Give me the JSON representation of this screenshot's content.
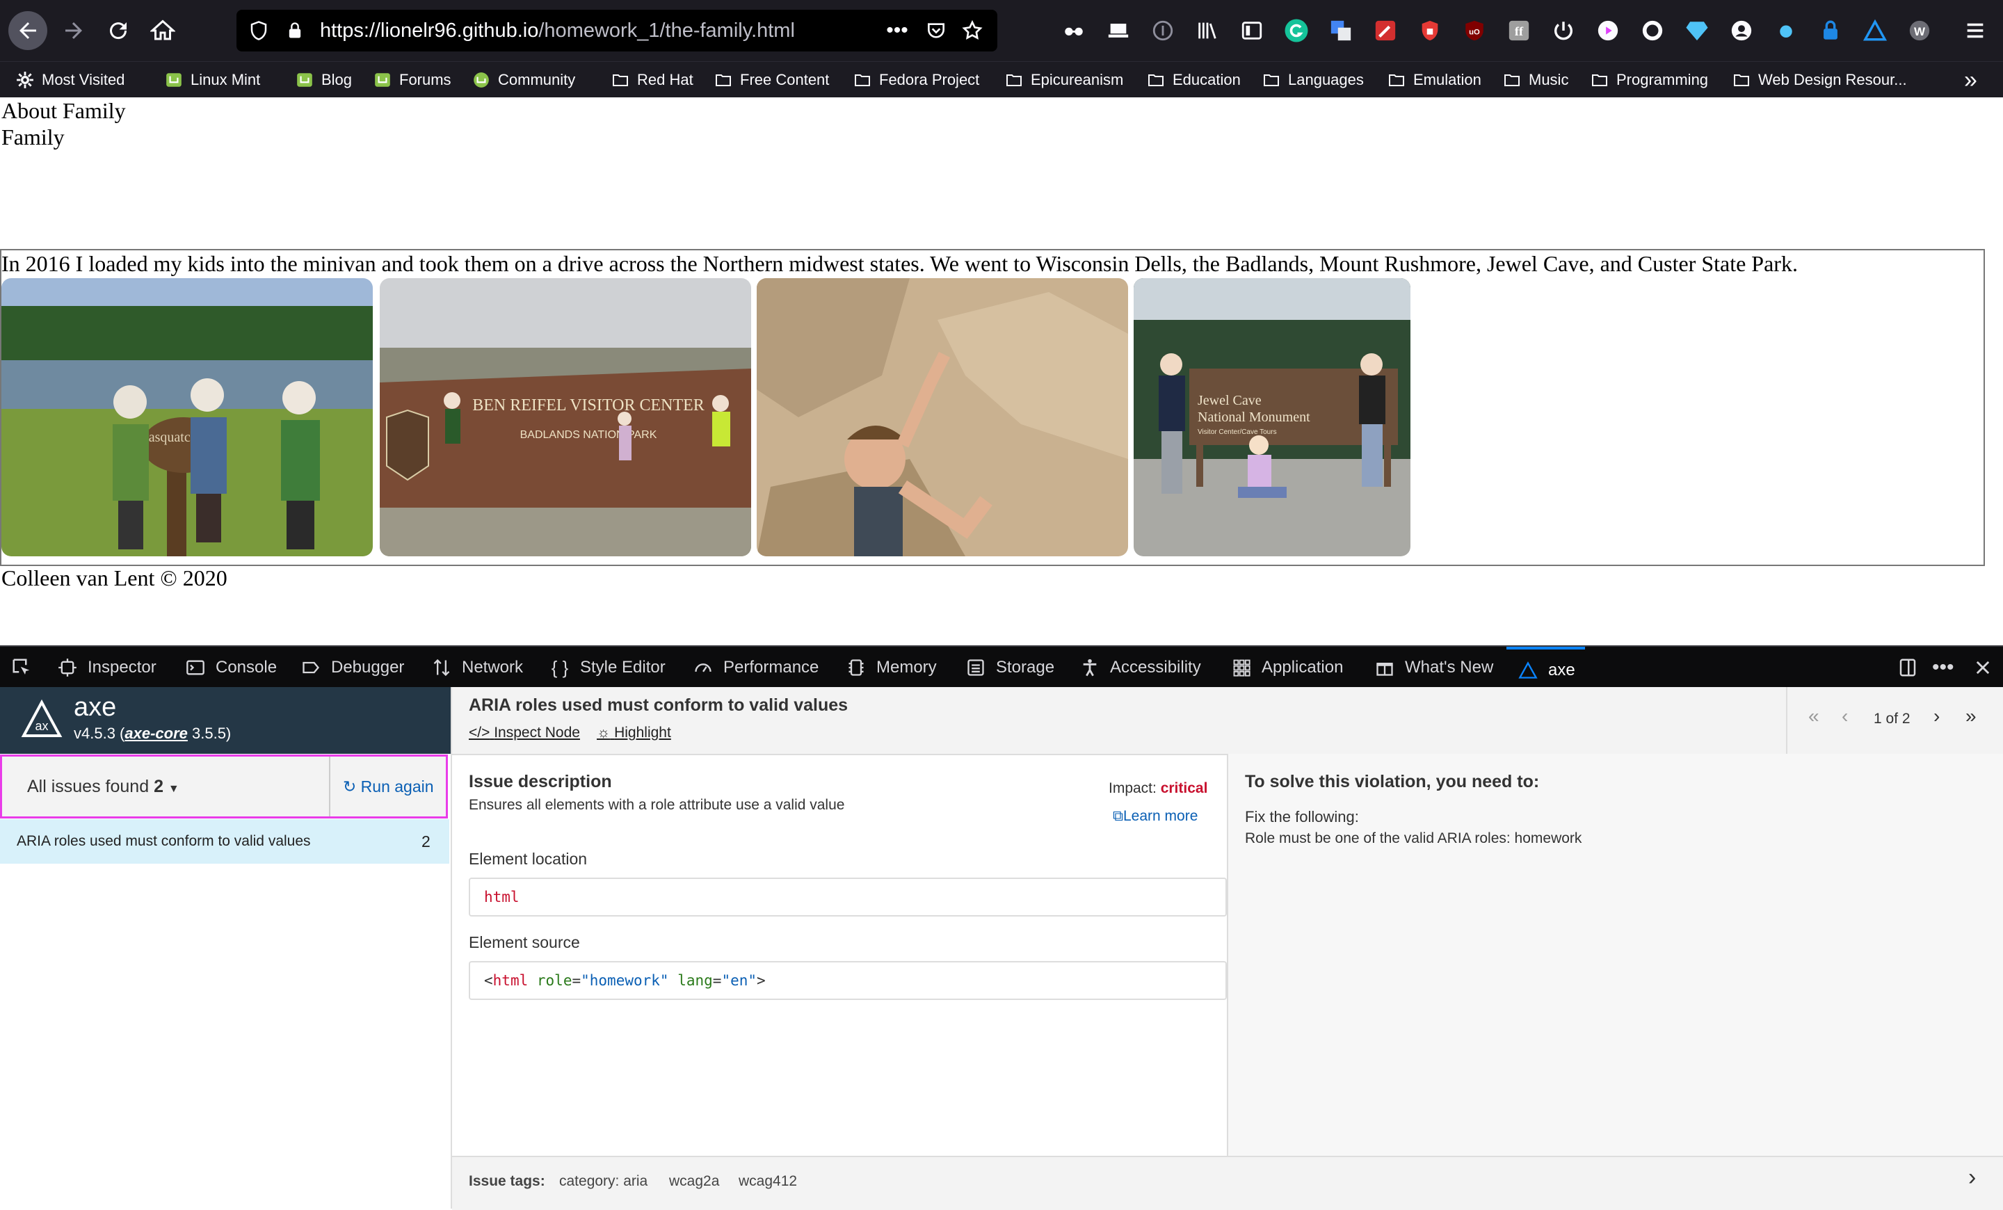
{
  "browser": {
    "url_host": "https://lionelr96.github.io",
    "url_path": "/homework_1/the-family.html",
    "bookmarks": [
      {
        "label": "Most Visited",
        "icon": "gear-icon"
      },
      {
        "label": "Linux Mint",
        "icon": "mint-logo-icon"
      },
      {
        "label": "Blog",
        "icon": "mint-logo-icon"
      },
      {
        "label": "Forums",
        "icon": "mint-logo-icon"
      },
      {
        "label": "Community",
        "icon": "mint-logo-icon"
      },
      {
        "label": "Red Hat",
        "icon": "folder-icon"
      },
      {
        "label": "Free Content",
        "icon": "folder-icon"
      },
      {
        "label": "Fedora Project",
        "icon": "folder-icon"
      },
      {
        "label": "Epicureanism",
        "icon": "folder-icon"
      },
      {
        "label": "Education",
        "icon": "folder-icon"
      },
      {
        "label": "Languages",
        "icon": "folder-icon"
      },
      {
        "label": "Emulation",
        "icon": "folder-icon"
      },
      {
        "label": "Music",
        "icon": "folder-icon"
      },
      {
        "label": "Programming",
        "icon": "folder-icon"
      },
      {
        "label": "Web Design Resour..."
      }
    ],
    "overflow_label": "»"
  },
  "page": {
    "heading1": "About Family",
    "heading2": "Family",
    "paragraph": "In 2016 I loaded my kids into the minivan and took them on a drive across the Northern midwest states. We went to Wisconsin Dells, the Badlands, Mount Rushmore, Jewel Cave, and Custer State Park.",
    "photos": [
      {
        "sign": "sasquatch lake"
      },
      {
        "sign_line1": "BEN REIFEL VISITOR CENTER",
        "sign_line2": "BADLANDS NATION   PARK"
      },
      {},
      {
        "sign_line1": "Jewel Cave",
        "sign_line2": "National Monument",
        "sign_small": "Visitor Center/Cave Tours"
      }
    ],
    "footer": "Colleen van Lent © 2020"
  },
  "devtools": {
    "tabs": [
      {
        "label": "Inspector",
        "icon": "inspector-icon"
      },
      {
        "label": "Console",
        "icon": "console-icon"
      },
      {
        "label": "Debugger",
        "icon": "debugger-icon"
      },
      {
        "label": "Network",
        "icon": "network-icon"
      },
      {
        "label": "Style Editor",
        "icon": "style-editor-icon"
      },
      {
        "label": "Performance",
        "icon": "performance-icon"
      },
      {
        "label": "Memory",
        "icon": "memory-icon"
      },
      {
        "label": "Storage",
        "icon": "storage-icon"
      },
      {
        "label": "Accessibility",
        "icon": "accessibility-icon"
      },
      {
        "label": "Application",
        "icon": "application-icon"
      },
      {
        "label": "What's New",
        "icon": "gift-icon"
      },
      {
        "label": "axe",
        "icon": "axe-logo-icon",
        "active": true
      }
    ]
  },
  "axe": {
    "brand": "axe",
    "version_prefix": "v4.5.3 (",
    "core_label": "axe-core",
    "core_version": " 3.5.5)",
    "filter_label": "All issues found",
    "filter_count": "2",
    "run_again": "Run again",
    "issues": [
      {
        "title": "ARIA roles used must conform to valid values",
        "count": "2"
      }
    ],
    "detail": {
      "title": "ARIA roles used must conform to valid values",
      "inspect_node": "Inspect Node",
      "highlight": "Highlight",
      "pager": "1 of 2",
      "description_heading": "Issue description",
      "description": "Ensures all elements with a role attribute use a valid value",
      "impact_label": "Impact:",
      "impact_value": "critical",
      "learn_more": "Learn more",
      "location_heading": "Element location",
      "location_value": "html",
      "source_heading": "Element source",
      "source_tag": "html",
      "source_attr1": "role",
      "source_val1": "\"homework\"",
      "source_attr2": "lang",
      "source_val2": "\"en\"",
      "solve_heading": "To solve this violation, you need to:",
      "fix_heading": "Fix the following:",
      "fix_text": "Role must be one of the valid ARIA roles: homework",
      "tags_label": "Issue tags:",
      "tags": [
        "category: aria",
        "wcag2a",
        "wcag412"
      ]
    },
    "colors": {
      "critical": "#c8102e",
      "link": "#0a5fb4",
      "highlight_border": "#e93ce9",
      "selected_row": "#d8f1fa"
    }
  }
}
